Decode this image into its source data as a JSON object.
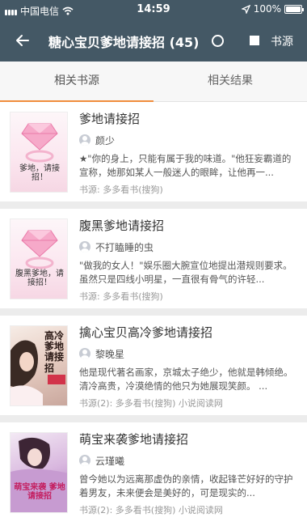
{
  "status_bar": {
    "carrier": "中国电信",
    "time": "14:59",
    "battery": "100%",
    "battery_level": 1.0
  },
  "header": {
    "title": "糖心宝贝爹地请接招 (45)",
    "source_label": "书源"
  },
  "tabs": [
    {
      "label": "相关书源",
      "active": true
    },
    {
      "label": "相关结果",
      "active": false
    }
  ],
  "books": [
    {
      "title": "爹地请接招",
      "author": "颜少",
      "description": "★\"你的身上，只能有属于我的味道。\"他狂妄霸道的宣称，她那如某人一般迷人的眼眸，让他再一...",
      "source": "书源: 多多看书(搜狗)",
      "cover_text": "爹地，请接招！"
    },
    {
      "title": "腹黑爹地请接招",
      "author": "不打瞌睡的虫",
      "description": "\"做我的女人！\"娱乐圈大腕宣位地提出潜规则要求。 虽然只是四线小明星，一直很有骨气的许轻...",
      "source": "书源: 多多看书(搜狗)",
      "cover_text": "腹黑爹地，请接招！"
    },
    {
      "title": "擒心宝贝高冷爹地请接招",
      "author": "黎晚星",
      "description": "他是现代著名画家，京城太子绝少，他就是韩倾绝。清冷高贵，冷漠绝情的他只为她展现笑颜。 ...",
      "source": "书源(2): 多多看书(搜狗) 小说阅读网",
      "cover_text": "高冷爹地请接招"
    },
    {
      "title": "萌宝来袭爹地请接招",
      "author": "云瑾曦",
      "description": "曾今她以为远离那虚伪的亲情，收起锋芒好好的守护着男友，未来便会是美好的，可是现实的...",
      "source": "书源(2): 多多看书(搜狗) 小说阅读网",
      "cover_text": "萌宝来袭 爹地请接招"
    }
  ],
  "colors": {
    "header_bg": "#445865",
    "tab_accent": "#f08c3c",
    "page_bg": "#ececec"
  },
  "icons": {
    "back": "arrow-left-icon",
    "circle": "circle-icon",
    "square": "square-icon",
    "author": "user-icon"
  }
}
